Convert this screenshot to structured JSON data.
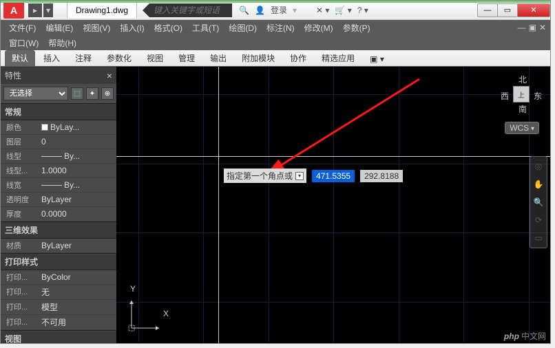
{
  "title": {
    "filename": "Drawing1.dwg",
    "search_placeholder": "键入关键字或短语",
    "login": "登录"
  },
  "compass": {
    "n": "北",
    "s": "南",
    "e": "东",
    "w": "西",
    "top": "上",
    "wcs": "WCS"
  },
  "axes": {
    "x": "X",
    "y": "Y"
  },
  "menus": [
    "文件(F)",
    "编辑(E)",
    "视图(V)",
    "插入(I)",
    "格式(O)",
    "工具(T)",
    "绘图(D)",
    "标注(N)",
    "修改(M)",
    "参数(P)"
  ],
  "menus2": [
    "窗口(W)",
    "帮助(H)"
  ],
  "ribbon_tabs": [
    "默认",
    "插入",
    "注释",
    "参数化",
    "视图",
    "管理",
    "输出",
    "附加模块",
    "协作",
    "精选应用"
  ],
  "props": {
    "title": "特性",
    "selection": "无选择",
    "sections": {
      "general": {
        "label": "常规",
        "rows": [
          {
            "k": "颜色",
            "v": "ByLay...",
            "swatch": true
          },
          {
            "k": "图层",
            "v": "0"
          },
          {
            "k": "线型",
            "v": "By...",
            "line": true
          },
          {
            "k": "线型...",
            "v": "1.0000"
          },
          {
            "k": "线宽",
            "v": "By...",
            "line": true
          },
          {
            "k": "透明度",
            "v": "ByLayer"
          },
          {
            "k": "厚度",
            "v": "0.0000"
          }
        ]
      },
      "threeD": {
        "label": "三维效果",
        "rows": [
          {
            "k": "材质",
            "v": "ByLayer"
          }
        ]
      },
      "plot": {
        "label": "打印样式",
        "rows": [
          {
            "k": "打印...",
            "v": "ByColor"
          },
          {
            "k": "打印...",
            "v": "无"
          },
          {
            "k": "打印...",
            "v": "模型"
          },
          {
            "k": "打印...",
            "v": "不可用"
          }
        ]
      },
      "view": {
        "label": "视图"
      }
    }
  },
  "dynamic_input": {
    "prompt": "指定第一个角点或",
    "x": "471.5355",
    "y": "292.8188"
  },
  "watermark": {
    "brand": "php",
    "text": "中文网"
  }
}
